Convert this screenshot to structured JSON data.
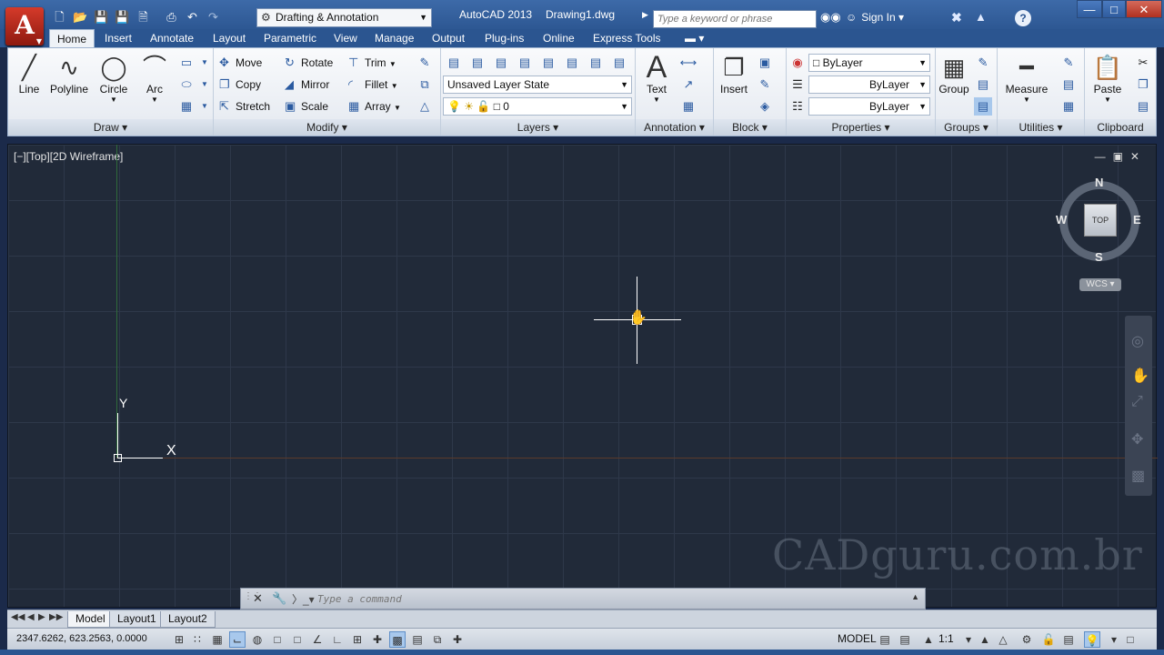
{
  "titlebar": {
    "workspace": "Drafting & Annotation",
    "app_name": "AutoCAD 2013",
    "file_name": "Drawing1.dwg",
    "search_placeholder": "Type a keyword or phrase",
    "sign_in": "Sign In"
  },
  "tabs": [
    "Home",
    "Insert",
    "Annotate",
    "Layout",
    "Parametric",
    "View",
    "Manage",
    "Output",
    "Plug-ins",
    "Online",
    "Express Tools"
  ],
  "draw": {
    "title": "Draw",
    "line": "Line",
    "polyline": "Polyline",
    "circle": "Circle",
    "arc": "Arc"
  },
  "modify": {
    "title": "Modify",
    "move": "Move",
    "rotate": "Rotate",
    "trim": "Trim",
    "copy": "Copy",
    "mirror": "Mirror",
    "fillet": "Fillet",
    "stretch": "Stretch",
    "scale": "Scale",
    "array": "Array"
  },
  "layers": {
    "title": "Layers",
    "layer_state": "Unsaved Layer State",
    "current_layer": "0"
  },
  "annotation": {
    "title": "Annotation",
    "text": "Text"
  },
  "block": {
    "title": "Block",
    "insert": "Insert"
  },
  "properties": {
    "title": "Properties",
    "color": "ByLayer",
    "lineweight": "ByLayer",
    "linetype": "ByLayer"
  },
  "groups": {
    "title": "Groups",
    "group": "Group"
  },
  "utilities": {
    "title": "Utilities",
    "measure": "Measure"
  },
  "clipboard": {
    "title": "Clipboard",
    "paste": "Paste"
  },
  "viewport": {
    "label": "[−][Top][2D Wireframe]",
    "ucs_x": "X",
    "ucs_y": "Y",
    "viewcube_top": "TOP",
    "compass_n": "N",
    "compass_s": "S",
    "compass_e": "E",
    "compass_w": "W",
    "wcs": "WCS"
  },
  "command": {
    "placeholder": "Type a command"
  },
  "watermark": "CADguru.com.br",
  "layout_tabs": [
    "Model",
    "Layout1",
    "Layout2"
  ],
  "status": {
    "coords": "2347.6262, 623.2563, 0.0000",
    "model": "MODEL",
    "annotation_scale": "1:1"
  },
  "colors": {
    "titlebar": "#2b5590",
    "viewport_bg": "#212a39",
    "grid": "#2e384a"
  }
}
